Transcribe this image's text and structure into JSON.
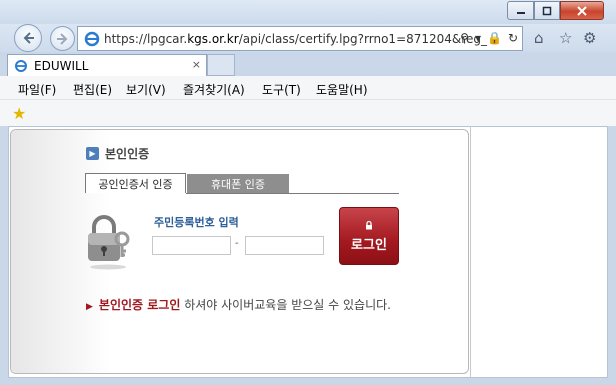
{
  "browser": {
    "url_prefix": "https://lpgcar.",
    "url_domain": "kgs.or.kr",
    "url_suffix": "/api/class/certify.lpg?rrno1=871204&reg_",
    "tab_title": "EDUWILL",
    "tab_close": "×",
    "menu": [
      "파일(F)",
      "편집(E)",
      "보기(V)",
      "즐겨찾기(A)",
      "도구(T)",
      "도움말(H)"
    ]
  },
  "page": {
    "heading": "본인인증",
    "tabs": [
      "공인인증서 인증",
      "휴대폰 인증"
    ],
    "form_label": "주민등록번호 입력",
    "dash": "-",
    "login_label": "로그인",
    "notice_strong": "본인인증 로그인",
    "notice_text": " 하셔야 사이버교육을 받으실 수 있습니다."
  },
  "colors": {
    "accent_blue": "#2e5f9a",
    "login_red": "#a3191f"
  },
  "icons": [
    "back-arrow-icon",
    "forward-arrow-icon",
    "ie-logo-icon",
    "search-icon",
    "refresh-icon",
    "home-icon",
    "favorites-star-icon",
    "settings-gear-icon",
    "lock-key-icon"
  ]
}
